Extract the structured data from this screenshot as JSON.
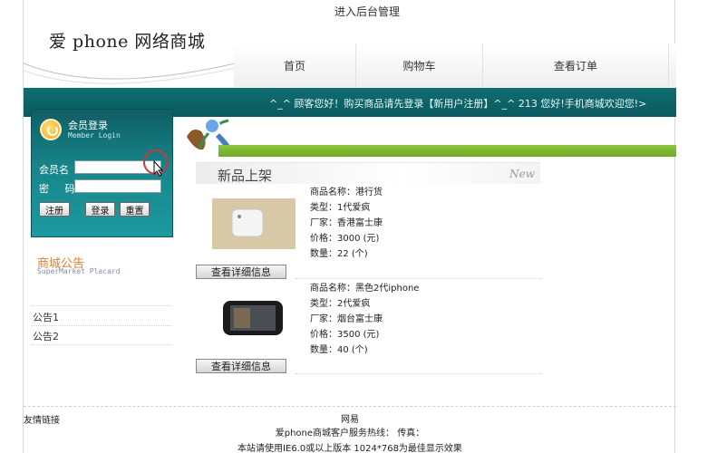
{
  "header": {
    "admin_link": "进入后台管理",
    "logo": "爱 phone 网络商城"
  },
  "nav": {
    "items": [
      "首页",
      "购物车",
      "查看订单"
    ]
  },
  "banner": {
    "text": "^_^ 顾客您好！购买商品请先登录【新用户注册】^_^ 213 您好!手机商城欢迎您!>"
  },
  "login": {
    "title": "会员登录",
    "subtitle": "Member Login",
    "username_label": "会员名",
    "password_label": "密  码",
    "register_button": "注册",
    "login_button": "登录",
    "reset_button": "重置",
    "username_value": "",
    "password_value": ""
  },
  "notice": {
    "title": "商城公告",
    "subtitle": "SuperMarket Placard",
    "items": [
      "公告1",
      "公告2"
    ]
  },
  "new_products": {
    "title": "新品上架",
    "tag": "New"
  },
  "products": [
    {
      "name": "商品名称：港行货",
      "type": "类型：1代爱疯",
      "vendor": "厂家：香港富士康",
      "price": "价格：3000 (元)",
      "quantity": "数量：22 (个)",
      "detail_button": "查看详细信息"
    },
    {
      "name": "商品名称：黑色2代iphone",
      "type": "类型：2代爱疯",
      "vendor": "厂家：烟台富士康",
      "price": "价格：3500 (元)",
      "quantity": "数量：40 (个)",
      "detail_button": "查看详细信息"
    }
  ],
  "footer": {
    "friend_links": "友情链接",
    "company": "网易",
    "hotline": "爱phone商城客户服务热线：  传真：",
    "browser_note": "本站请使用IE6.0或以上版本 1024*768为最佳显示效果"
  },
  "colors": {
    "banner": "#0f6d72",
    "green_bar": "#8dc63f",
    "notice_title": "#e0802a"
  }
}
